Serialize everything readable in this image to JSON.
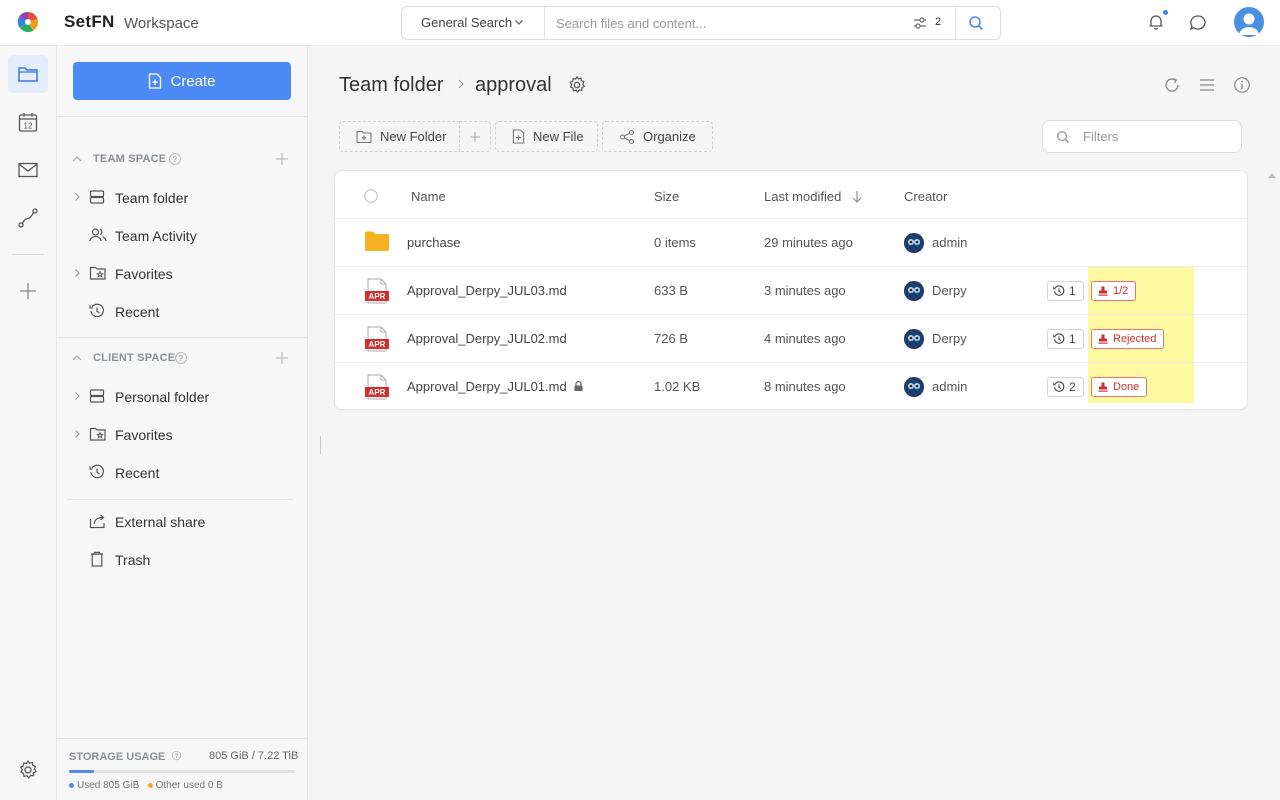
{
  "header": {
    "brand": "SetFN",
    "workspace": "Workspace",
    "search_scope": "General Search",
    "search_placeholder": "Search files and content...",
    "filter_count": "2"
  },
  "colors": {
    "accent": "#4c8bf5",
    "folder": "#f5b324",
    "apr_red": "#d32f2f",
    "status_red": "#d32f2f",
    "highlight": "#fcf88f"
  },
  "rail": {
    "items": [
      "folder-icon",
      "calendar-icon",
      "mail-icon",
      "route-icon",
      "plus-icon"
    ],
    "calendar_day": "12",
    "settings_icon": "gear-icon"
  },
  "sidebar": {
    "create_label": "Create",
    "team_space": {
      "title": "TEAM SPACE",
      "items": [
        {
          "label": "Team folder",
          "icon": "storage-icon"
        },
        {
          "label": "Team Activity",
          "icon": "users-icon"
        },
        {
          "label": "Favorites",
          "icon": "folder-star-icon"
        },
        {
          "label": "Recent",
          "icon": "history-icon"
        }
      ]
    },
    "client_space": {
      "title": "CLIENT SPACE",
      "items": [
        {
          "label": "Personal folder",
          "icon": "storage-icon"
        },
        {
          "label": "Favorites",
          "icon": "folder-star-icon"
        },
        {
          "label": "Recent",
          "icon": "history-icon"
        }
      ]
    },
    "external_share": "External share",
    "trash": "Trash",
    "storage": {
      "title": "STORAGE USAGE",
      "value": "805 GiB / 7.22 TiB",
      "used_label": "Used 805 GiB",
      "other_label": "Other used 0 B",
      "used_fraction": 0.11
    }
  },
  "main": {
    "breadcrumb": [
      "Team folder",
      "approval"
    ],
    "toolbar": {
      "new_folder": "New Folder",
      "new_file": "New File",
      "organize": "Organize",
      "filters_placeholder": "Filters"
    },
    "columns": {
      "name": "Name",
      "size": "Size",
      "modified": "Last modified",
      "creator": "Creator"
    },
    "rows": [
      {
        "name": "purchase",
        "type": "folder",
        "size": "0 items",
        "modified": "29 minutes ago",
        "creator": "admin"
      },
      {
        "name": "Approval_Derpy_JUL03.md",
        "type": "apr",
        "size": "633 B",
        "modified": "3 minutes ago",
        "creator": "Derpy",
        "versions": "1",
        "status": "1/2"
      },
      {
        "name": "Approval_Derpy_JUL02.md",
        "type": "apr",
        "size": "726 B",
        "modified": "4 minutes ago",
        "creator": "Derpy",
        "versions": "1",
        "status": "Rejected"
      },
      {
        "name": "Approval_Derpy_JUL01.md",
        "type": "apr",
        "size": "1.02 KB",
        "modified": "8 minutes ago",
        "creator": "admin",
        "versions": "2",
        "status": "Done",
        "locked": true
      }
    ],
    "file_badge": "APR"
  }
}
